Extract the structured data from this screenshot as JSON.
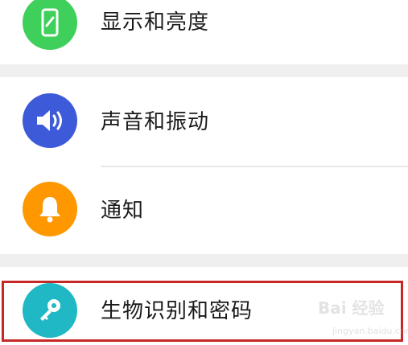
{
  "settings": {
    "items": [
      {
        "label": "显示和亮度",
        "icon": "phone-brightness-icon",
        "color": "#3fcf5b"
      },
      {
        "label": "声音和振动",
        "icon": "speaker-icon",
        "color": "#3d5bd9"
      },
      {
        "label": "通知",
        "icon": "bell-icon",
        "color": "#ff9800"
      },
      {
        "label": "生物识别和密码",
        "icon": "key-icon",
        "color": "#1fb8c4"
      }
    ]
  },
  "watermark": {
    "brand": "Bai 经验",
    "url": "jingyan.baidu.com"
  },
  "colors": {
    "background": "#efefef",
    "card": "#ffffff",
    "highlight_border": "#c62828"
  }
}
